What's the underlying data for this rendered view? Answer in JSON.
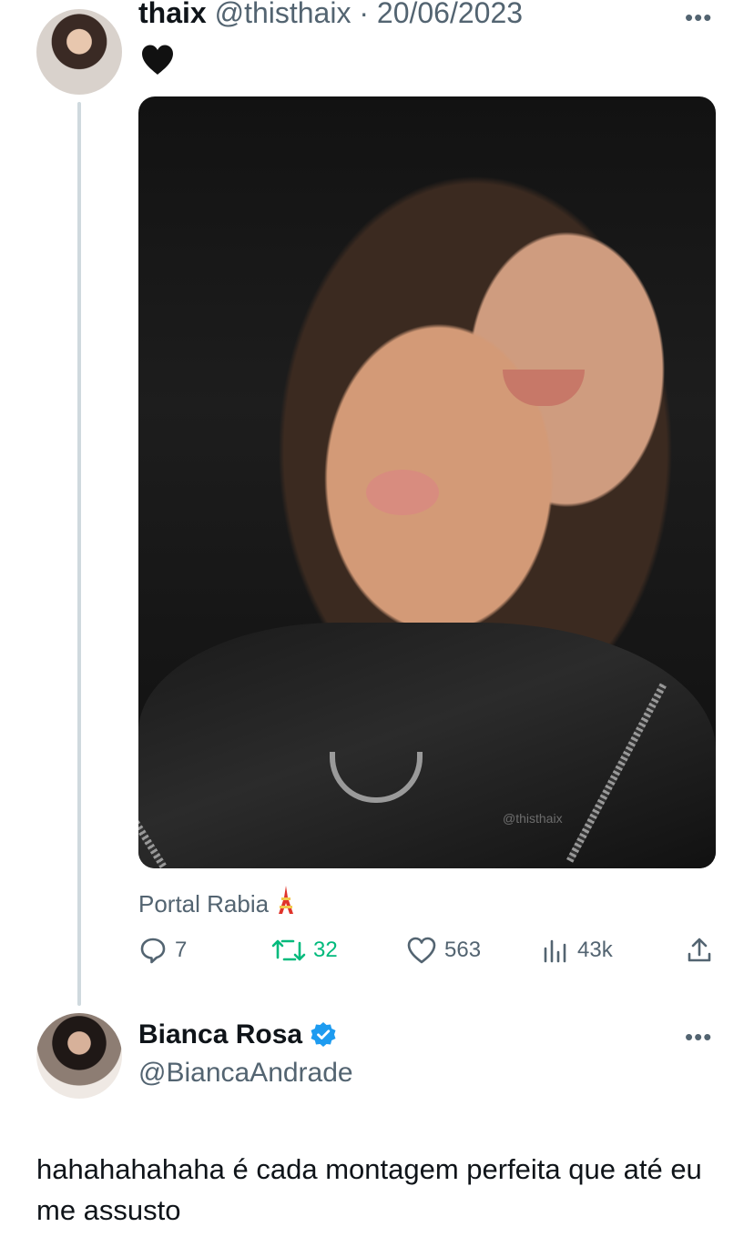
{
  "tweet1": {
    "name": "thaix",
    "handle": "@thisthaix",
    "date": "20/06/2023",
    "text": "🖤",
    "image": {
      "watermark": "@thisthaix"
    },
    "source": "Portal Rabia",
    "source_icon": "tokyo-tower-icon",
    "stats": {
      "replies": "7",
      "retweets": "32",
      "likes": "563",
      "views": "43k"
    },
    "retweet_color": "#00ba7c"
  },
  "reply": {
    "name": "Bianca Rosa",
    "handle": "@BiancaAndrade",
    "verified_color": "#1d9bf0",
    "text": "hahahahahaha é cada montagem perfeita que até eu me assusto"
  }
}
